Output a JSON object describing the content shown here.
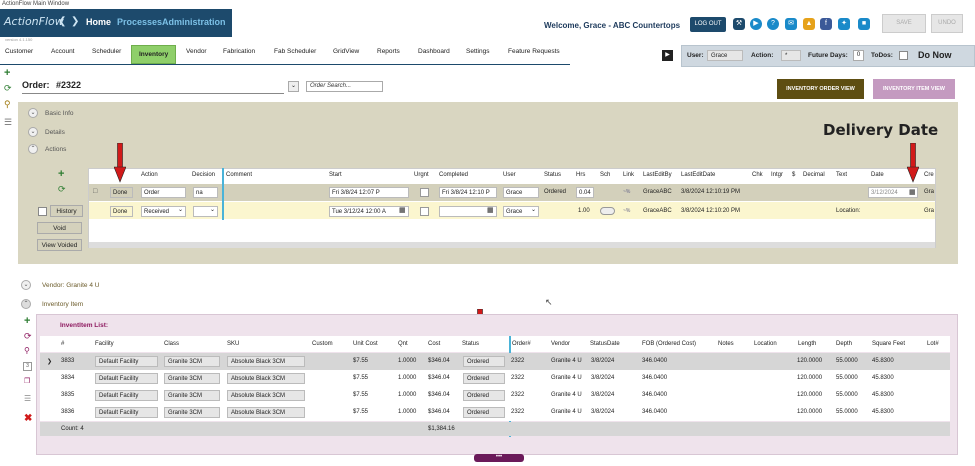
{
  "window": {
    "title": "ActionFlow Main Window"
  },
  "brand": {
    "logo": "ActionFlow",
    "nav_home": "Home",
    "nav_processes": "Processes",
    "nav_admin": "Administration",
    "version": "version 4.1.150"
  },
  "header": {
    "welcome": "Welcome, Grace - ABC Countertops",
    "logout": "LOG OUT",
    "save": "SAVE",
    "undo": "UNDO"
  },
  "tabs": [
    "Customer",
    "Account",
    "Scheduler",
    "Inventory",
    "Vendor",
    "Fabrication",
    "Fab Scheduler",
    "GridView",
    "Reports",
    "Dashboard",
    "Settings",
    "Feature Requests"
  ],
  "filters": {
    "user_label": "User:",
    "user_value": "Grace",
    "action_label": "Action:",
    "action_value": "*",
    "future_label": "Future Days:",
    "future_value": "0",
    "todos_label": "ToDos:",
    "donow": "Do Now"
  },
  "order": {
    "label": "Order:",
    "number": "#2322",
    "search_placeholder": "Order Search...",
    "btn_order_view": "INVENTORY ORDER VIEW",
    "btn_item_view": "INVENTORY ITEM VIEW"
  },
  "sections": {
    "basic": "Basic Info",
    "details": "Details",
    "actions": "Actions",
    "vendor": "Vendor: Granite 4 U",
    "inventory_item": "Inventory Item",
    "list": "InventItem List:"
  },
  "annotation": "Delivery Date",
  "action_buttons": {
    "history": "History",
    "void": "Void",
    "view_voided": "View Voided"
  },
  "action_columns": [
    "Action",
    "Decision",
    "Comment",
    "Start",
    "Urgnt",
    "Completed",
    "User",
    "Status",
    "Hrs",
    "Sch",
    "Link",
    "LastEditBy",
    "LastEditDate",
    "Chk",
    "Intgr",
    "$",
    "Decimal",
    "Text",
    "Date",
    "Cre"
  ],
  "action_rows": [
    {
      "done": "Done",
      "action": "Order",
      "decision": "na",
      "start": "Fri 3/8/24 12:07 P",
      "completed": "Fri 3/8/24 12:10 P",
      "user": "Grace",
      "status": "Ordered",
      "hrs": "0.04",
      "lastedit": "GraceABC",
      "lasteditdate": "3/8/2024 12:10:19 PM",
      "date": "3/12/2024",
      "cre": "Gra"
    },
    {
      "done": "Done",
      "action": "Received",
      "decision": "",
      "start": "Tue 3/12/24 12:00 A",
      "completed": "",
      "user": "Grace",
      "status": "",
      "hrs": "1.00",
      "lastedit": "GraceABC",
      "lasteditdate": "3/8/2024 12:10:20 PM",
      "text": "Location:",
      "cre": "Gra"
    }
  ],
  "item_columns": [
    "#",
    "Facility",
    "Class",
    "SKU",
    "Custom",
    "Unit Cost",
    "Qnt",
    "Cost",
    "Status",
    "Order#",
    "Vendor",
    "StatusDate",
    "FOB (Ordered Cost)",
    "Notes",
    "Location",
    "Length",
    "Depth",
    "Square Feet",
    "Lot#"
  ],
  "item_rows": [
    {
      "num": "3833",
      "facility": "Default Facility",
      "class": "Granite 3CM",
      "sku": "Absolute Black 3CM",
      "unit_cost": "$7.55",
      "qnt": "1.0000",
      "cost": "$346.04",
      "status": "Ordered",
      "order": "2322",
      "vendor": "Granite 4 U",
      "statusdate": "3/8/2024",
      "fob": "346.0400",
      "length": "120.0000",
      "depth": "55.0000",
      "sqft": "45.8300"
    },
    {
      "num": "3834",
      "facility": "Default Facility",
      "class": "Granite 3CM",
      "sku": "Absolute Black 3CM",
      "unit_cost": "$7.55",
      "qnt": "1.0000",
      "cost": "$346.04",
      "status": "Ordered",
      "order": "2322",
      "vendor": "Granite 4 U",
      "statusdate": "3/8/2024",
      "fob": "346.0400",
      "length": "120.0000",
      "depth": "55.0000",
      "sqft": "45.8300"
    },
    {
      "num": "3835",
      "facility": "Default Facility",
      "class": "Granite 3CM",
      "sku": "Absolute Black 3CM",
      "unit_cost": "$7.55",
      "qnt": "1.0000",
      "cost": "$346.04",
      "status": "Ordered",
      "order": "2322",
      "vendor": "Granite 4 U",
      "statusdate": "3/8/2024",
      "fob": "346.0400",
      "length": "120.0000",
      "depth": "55.0000",
      "sqft": "45.8300"
    },
    {
      "num": "3836",
      "facility": "Default Facility",
      "class": "Granite 3CM",
      "sku": "Absolute Black 3CM",
      "unit_cost": "$7.55",
      "qnt": "1.0000",
      "cost": "$346.04",
      "status": "Ordered",
      "order": "2322",
      "vendor": "Granite 4 U",
      "statusdate": "3/8/2024",
      "fob": "346.0400",
      "length": "120.0000",
      "depth": "55.0000",
      "sqft": "45.8300"
    }
  ],
  "footer": {
    "count": "Count: 4",
    "total": "$1,384.16"
  },
  "colors": {
    "brand": "#1d4a6c",
    "active_tab": "#8fcf6a",
    "arrow": "#d11a1a",
    "panel": "#d9d6c1",
    "inv_panel": "#efe3ec",
    "order_view_btn": "#5e4e12",
    "item_view_btn": "#c49ac0"
  }
}
